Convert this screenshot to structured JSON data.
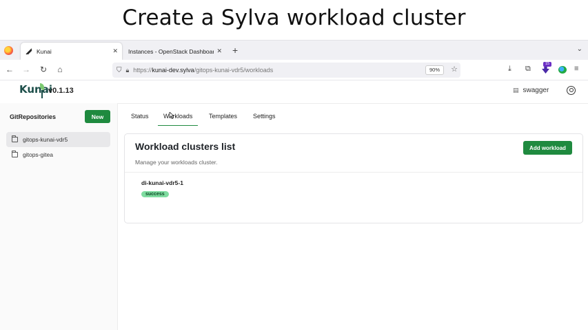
{
  "slide": {
    "title": "Create a Sylva workload cluster"
  },
  "browser": {
    "tabs": [
      {
        "label": "Kunai",
        "icon": "kunai-favicon-icon",
        "close": "✕"
      },
      {
        "label": "Instances - OpenStack Dashboard",
        "close": "✕"
      }
    ],
    "new_tab": "+",
    "tab_list": "⌄",
    "url": {
      "prefix": "https://",
      "host": "kunai-dev.sylva",
      "path": "/gitops-kunai-vdr5/workloads"
    },
    "zoom": "90%",
    "extension_badge": "15"
  },
  "app": {
    "logo": "Kunai",
    "version": "v0.1.13",
    "swagger_label": "swagger"
  },
  "sidebar": {
    "title": "GitRepositories",
    "new_label": "New",
    "items": [
      {
        "label": "gitops-kunai-vdr5",
        "selected": true
      },
      {
        "label": "gitops-gitea",
        "selected": false
      }
    ]
  },
  "tabs": {
    "items": [
      {
        "label": "Status"
      },
      {
        "label": "Workloads",
        "active": true
      },
      {
        "label": "Templates"
      },
      {
        "label": "Settings"
      }
    ]
  },
  "workloads": {
    "title": "Workload clusters list",
    "subtitle": "Manage your workloads cluster.",
    "add_label": "Add workload",
    "clusters": [
      {
        "name": "di-kunai-vdr5-1",
        "status": "success"
      }
    ]
  },
  "colors": {
    "accent": "#1f8a3f",
    "success_badge": "#7fdca0"
  }
}
